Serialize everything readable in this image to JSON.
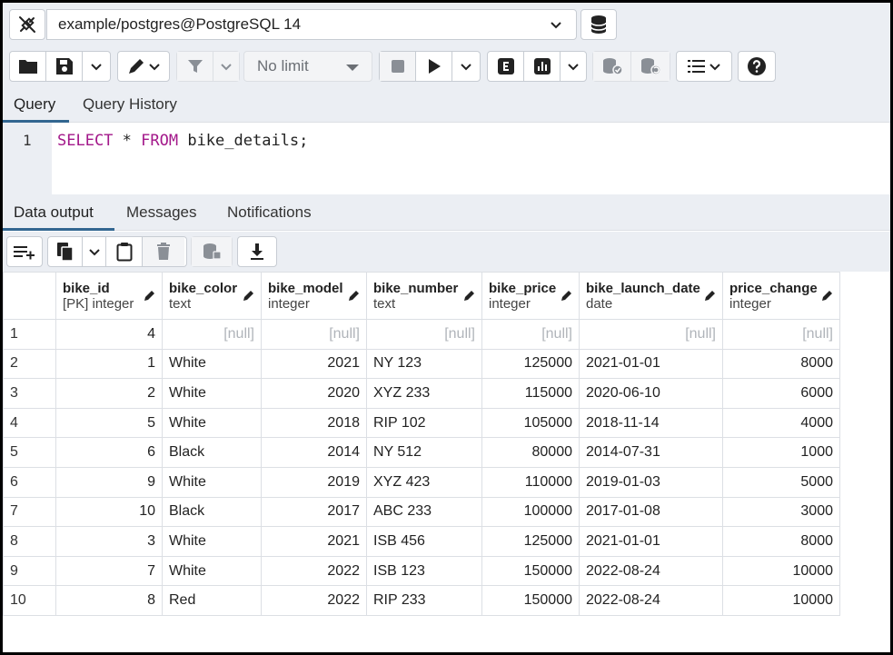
{
  "connection": {
    "label": "example/postgres@PostgreSQL 14"
  },
  "toolbar": {
    "limit_label": "No limit"
  },
  "query_tabs": [
    {
      "label": "Query"
    },
    {
      "label": "Query History"
    }
  ],
  "editor": {
    "line_number": "1",
    "kw1": "SELECT",
    "mid": " * ",
    "kw2": "FROM",
    "rest": " bike_details;"
  },
  "output_tabs": [
    {
      "label": "Data output"
    },
    {
      "label": "Messages"
    },
    {
      "label": "Notifications"
    }
  ],
  "columns": [
    {
      "name": "bike_id",
      "type": "[PK] integer"
    },
    {
      "name": "bike_color",
      "type": "text"
    },
    {
      "name": "bike_model",
      "type": "integer"
    },
    {
      "name": "bike_number",
      "type": "text"
    },
    {
      "name": "bike_price",
      "type": "integer"
    },
    {
      "name": "bike_launch_date",
      "type": "date"
    },
    {
      "name": "price_change",
      "type": "integer"
    }
  ],
  "rows": [
    {
      "n": "1",
      "cells": [
        "4",
        "[null]",
        "[null]",
        "[null]",
        "[null]",
        "[null]",
        "[null]"
      ]
    },
    {
      "n": "2",
      "cells": [
        "1",
        "White",
        "2021",
        "NY 123",
        "125000",
        "2021-01-01",
        "8000"
      ]
    },
    {
      "n": "3",
      "cells": [
        "2",
        "White",
        "2020",
        "XYZ 233",
        "115000",
        "2020-06-10",
        "6000"
      ]
    },
    {
      "n": "4",
      "cells": [
        "5",
        "White",
        "2018",
        "RIP 102",
        "105000",
        "2018-11-14",
        "4000"
      ]
    },
    {
      "n": "5",
      "cells": [
        "6",
        "Black",
        "2014",
        "NY 512",
        "80000",
        "2014-07-31",
        "1000"
      ]
    },
    {
      "n": "6",
      "cells": [
        "9",
        "White",
        "2019",
        "XYZ 423",
        "110000",
        "2019-01-03",
        "5000"
      ]
    },
    {
      "n": "7",
      "cells": [
        "10",
        "Black",
        "2017",
        "ABC 233",
        "100000",
        "2017-01-08",
        "3000"
      ]
    },
    {
      "n": "8",
      "cells": [
        "3",
        "White",
        "2021",
        "ISB 456",
        "125000",
        "2021-01-01",
        "8000"
      ]
    },
    {
      "n": "9",
      "cells": [
        "7",
        "White",
        "2022",
        "ISB 123",
        "150000",
        "2022-08-24",
        "10000"
      ]
    },
    {
      "n": "10",
      "cells": [
        "8",
        "Red",
        "2022",
        "RIP 233",
        "150000",
        "2022-08-24",
        "10000"
      ]
    }
  ]
}
